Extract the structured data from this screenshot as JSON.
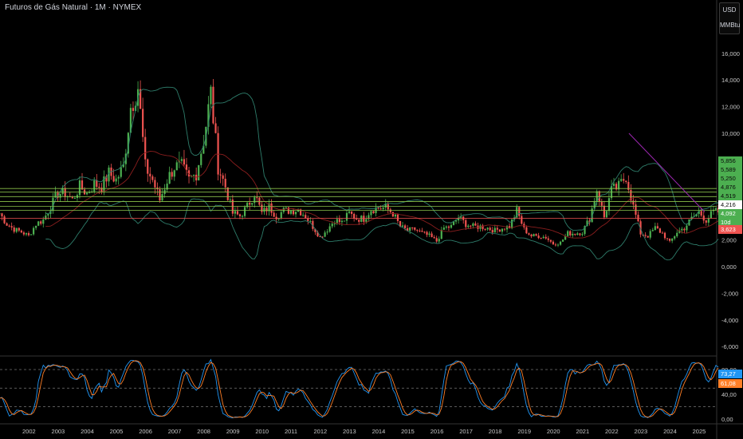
{
  "title": "Futuros de Gás Natural · 1M · NYMEX",
  "currency": "USD",
  "unit": "MMBtu",
  "colors": {
    "up": "#4caf50",
    "down": "#ef5350",
    "band": "#2e7d6b",
    "ma": "#8b1e1e",
    "level": "#8bc34a",
    "support": "#ef5350",
    "trend": "#9c27b0",
    "k": "#2196f3",
    "d": "#ff7f27"
  },
  "price_labels": [
    {
      "text": "5,856",
      "bg": "#4caf50",
      "fg": "#0a0a0a"
    },
    {
      "text": "5,589",
      "bg": "#4caf50",
      "fg": "#0a0a0a"
    },
    {
      "text": "5,250",
      "bg": "#4caf50",
      "fg": "#0a0a0a"
    },
    {
      "text": "4,876",
      "bg": "#4caf50",
      "fg": "#0a0a0a"
    },
    {
      "text": "4,519",
      "bg": "#4caf50",
      "fg": "#0a0a0a"
    },
    {
      "text": "4,216",
      "bg": "#ffffff",
      "fg": "#0a0a0a"
    },
    {
      "text": "4,092",
      "bg": "#4caf50",
      "fg": "#ffffff"
    },
    {
      "text": "10d 15h",
      "bg": "#4caf50",
      "fg": "#ffffff"
    },
    {
      "text": "3,623",
      "bg": "#ef5350",
      "fg": "#ffffff"
    }
  ],
  "stoch_labels": [
    {
      "text": "73,27",
      "bg": "#2196f3"
    },
    {
      "text": "61,08",
      "bg": "#ff7f27"
    }
  ],
  "chart_data": {
    "type": "candlestick",
    "title": "Futuros de Gás Natural · 1M · NYMEX",
    "ylabel": "USD/MMBtu",
    "ylim": [
      -7,
      17
    ],
    "yticks": [
      "16,000",
      "14,000",
      "12,000",
      "10,000",
      "2,000",
      "0,000",
      "-2,000",
      "-4,000",
      "-6,000"
    ],
    "ytick_values": [
      16,
      14,
      12,
      10,
      2,
      0,
      -2,
      -4,
      -6
    ],
    "xticks": [
      "2002",
      "2003",
      "2004",
      "2005",
      "2006",
      "2007",
      "2008",
      "2009",
      "2010",
      "2011",
      "2012",
      "2013",
      "2014",
      "2015",
      "2016",
      "2017",
      "2018",
      "2019",
      "2020",
      "2021",
      "2022",
      "2023",
      "2024",
      "2025"
    ],
    "start_year": 2001.0,
    "quarterly_close": [
      4.0,
      3.2,
      2.8,
      2.6,
      2.3,
      3.2,
      3.5,
      4.5,
      5.5,
      5.5,
      5.0,
      6.0,
      5.5,
      6.2,
      6.0,
      7.0,
      6.5,
      7.5,
      12.0,
      13.5,
      7.5,
      6.5,
      5.0,
      6.5,
      7.5,
      7.5,
      6.5,
      7.0,
      9.5,
      13.0,
      7.5,
      6.0,
      4.0,
      3.8,
      4.5,
      5.5,
      4.0,
      4.5,
      3.8,
      4.2,
      4.2,
      4.3,
      3.8,
      3.0,
      2.2,
      2.8,
      3.5,
      3.3,
      4.0,
      3.6,
      3.6,
      4.3,
      4.4,
      4.4,
      4.0,
      3.0,
      2.7,
      2.8,
      2.5,
      2.3,
      1.9,
      2.9,
      3.0,
      3.7,
      3.2,
      3.0,
      3.0,
      2.9,
      2.7,
      2.9,
      3.0,
      4.2,
      2.8,
      2.3,
      2.3,
      2.2,
      1.7,
      1.8,
      2.5,
      2.5,
      2.6,
      3.6,
      5.8,
      3.7,
      5.7,
      6.0,
      6.8,
      4.5,
      2.5,
      2.3,
      2.9,
      2.5,
      1.8,
      2.6,
      2.9,
      3.6,
      4.1,
      3.5,
      4.1
    ],
    "levels": [
      5.856,
      5.589,
      5.25,
      4.876,
      4.519,
      4.216
    ],
    "support": 3.623,
    "last_price": 4.092,
    "countdown": "10d 15h",
    "trendline": [
      [
        2022.6,
        10.0
      ],
      [
        2025.2,
        4.1
      ]
    ],
    "stochastic": {
      "yticks": [
        "80,00",
        "40,00",
        "0,00"
      ],
      "ytick_values": [
        80,
        40,
        0
      ],
      "bands": [
        80,
        50,
        20
      ],
      "k_last": 73.27,
      "d_last": 61.08
    }
  }
}
